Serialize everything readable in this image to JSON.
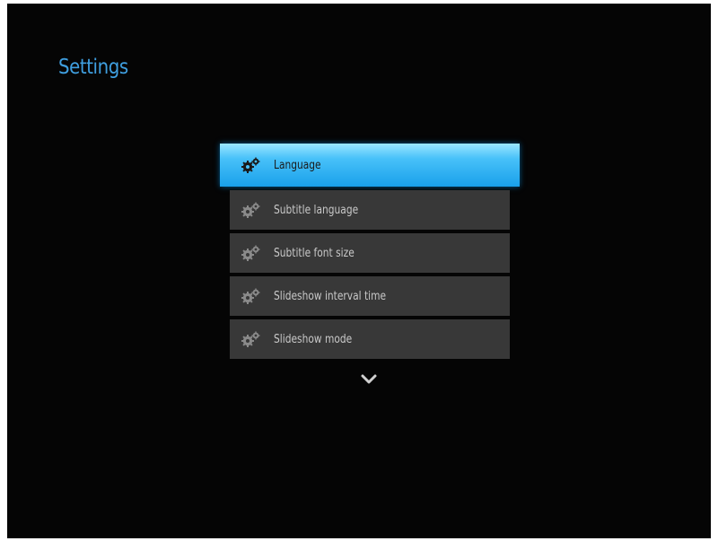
{
  "screen": {
    "title": "Settings"
  },
  "menu": {
    "items": [
      {
        "label": "Language",
        "icon": "gear-icon",
        "selected": true
      },
      {
        "label": "Subtitle language",
        "icon": "gear-icon",
        "selected": false
      },
      {
        "label": "Subtitle font size",
        "icon": "gear-icon",
        "selected": false
      },
      {
        "label": "Slideshow interval time",
        "icon": "gear-icon",
        "selected": false
      },
      {
        "label": "Slideshow mode",
        "icon": "gear-icon",
        "selected": false
      }
    ],
    "more_indicator": "chevron-down-icon"
  },
  "colors": {
    "background": "#050505",
    "title": "#3f9fe0",
    "item_background": "#383838",
    "selected_gradient_top": "#9ce6ff",
    "selected_gradient_bottom": "#19a0ea",
    "item_text": "#c9c9c9"
  }
}
